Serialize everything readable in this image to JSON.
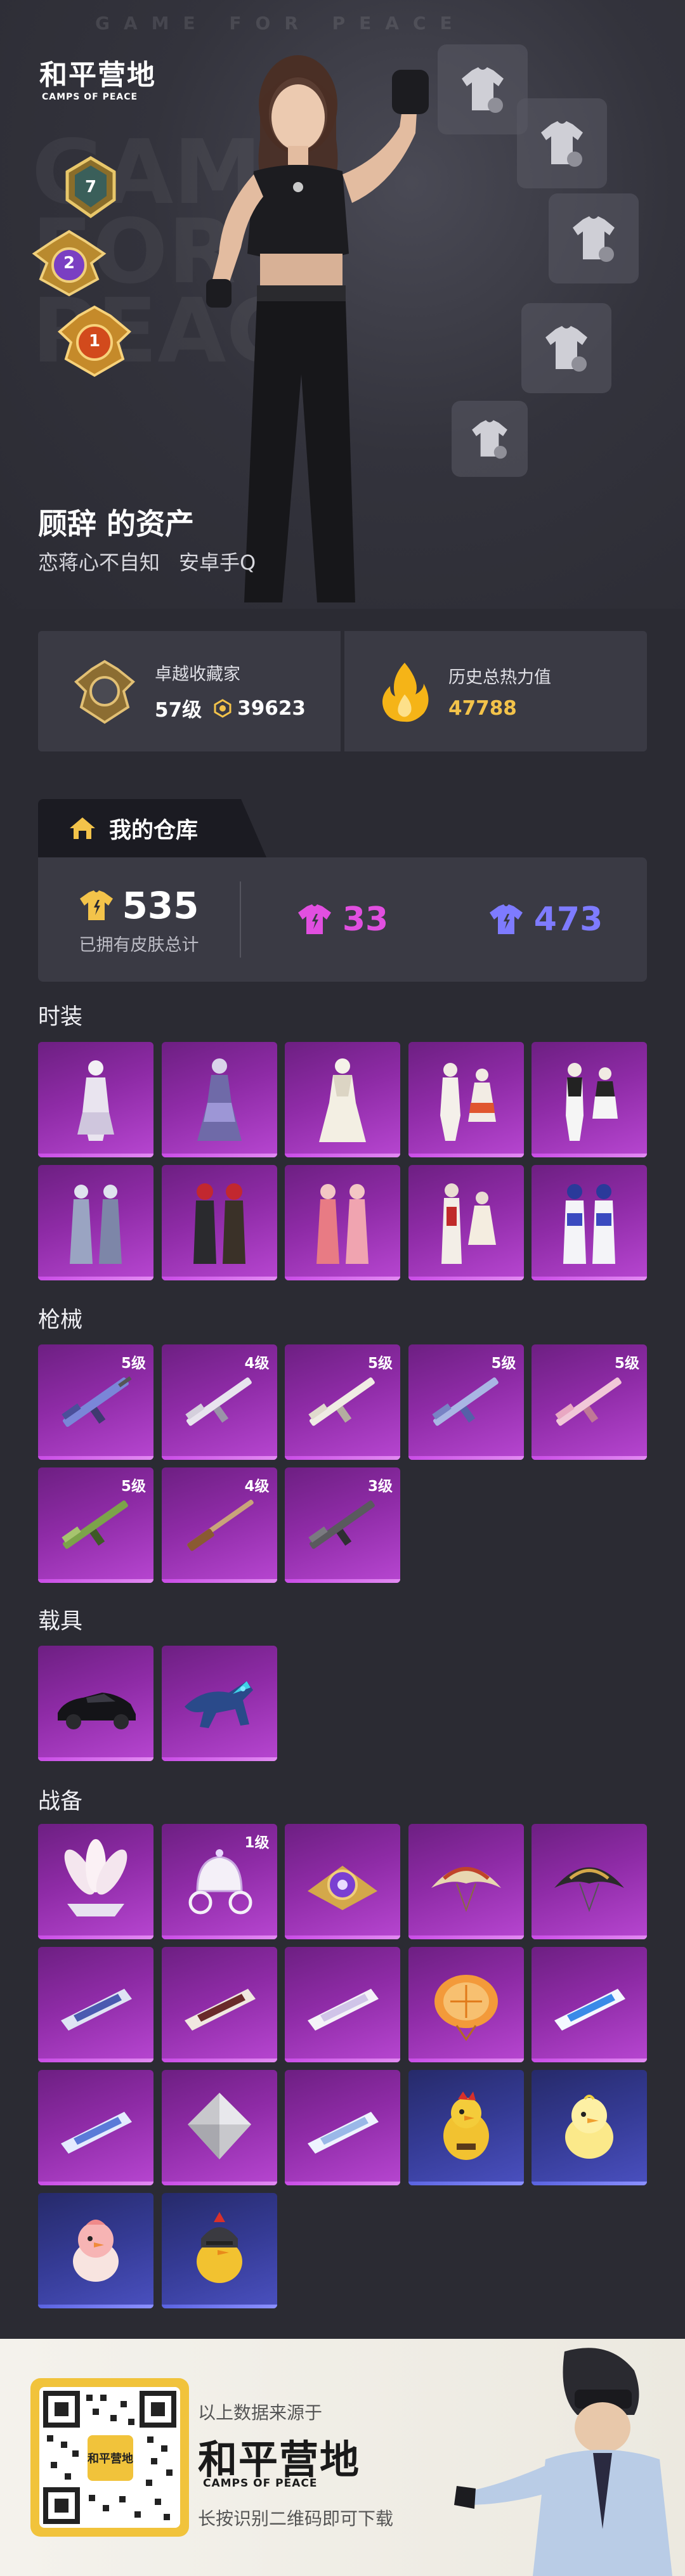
{
  "hero": {
    "bg_word": "GAME FOR PEACE",
    "ghost_lines": [
      "GAME",
      "FOR",
      "PEACE"
    ],
    "logo_cn": "和平营地",
    "logo_en": "CAMPS OF PEACE",
    "badges": [
      "7",
      "2",
      "1"
    ],
    "owner_title": "顾辞 的资产",
    "owner_subtitle": [
      "恋蒋心不自知",
      "安卓手Q"
    ]
  },
  "stats": {
    "collector_label": "卓越收藏家",
    "collector_level": "57级",
    "collector_points": "39623",
    "power_label": "历史总热力值",
    "power_value": "47788"
  },
  "warehouse": {
    "tab_label": "我的仓库",
    "total_count": "535",
    "total_caption": "已拥有皮肤总计",
    "purple_count": "33",
    "blue_count": "473",
    "colors": {
      "gold": "#f3c34a",
      "purple": "#e14fe0",
      "blue": "#7e7bff"
    }
  },
  "sections": {
    "fashion": {
      "title": "时装",
      "count": 10
    },
    "guns": {
      "title": "枪械",
      "levels": [
        "5级",
        "4级",
        "5级",
        "5级",
        "5级",
        "5级",
        "4级",
        "3级"
      ]
    },
    "vehicles": {
      "title": "载具",
      "count": 2
    },
    "gear": {
      "title": "战备",
      "levels": [
        "",
        "1级",
        "",
        "",
        "",
        "",
        "",
        "",
        "",
        "",
        "",
        "",
        "",
        "",
        "",
        "",
        ""
      ]
    }
  },
  "footer": {
    "source_text": "以上数据来源于",
    "logo_cn": "和平营地",
    "logo_en": "CAMPS OF PEACE",
    "scan_text": "长按识别二维码即可下载",
    "qr_badge": "和平营地"
  }
}
